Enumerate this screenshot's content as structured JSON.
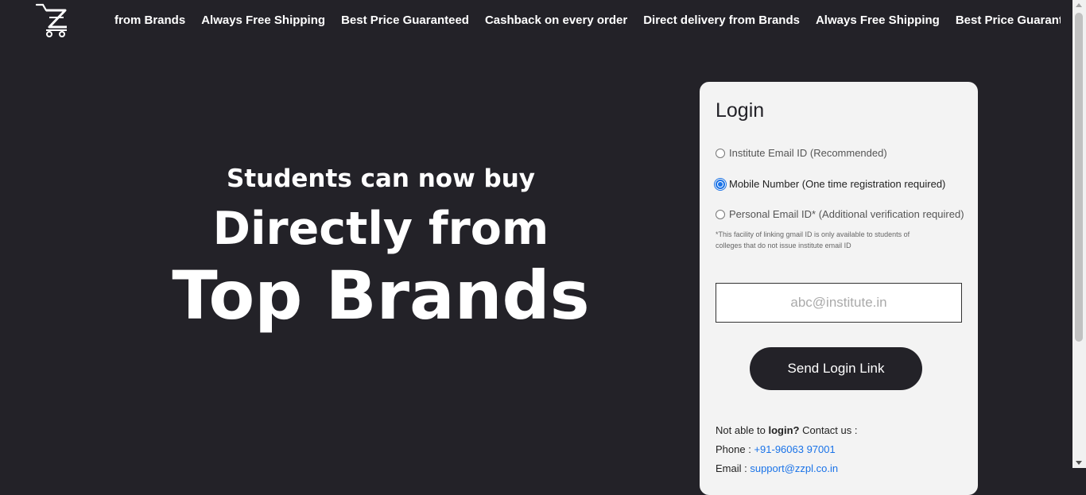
{
  "header": {
    "logo_icon": "cart-z-logo",
    "ticker": [
      "from Brands",
      "Always Free Shipping",
      "Best Price Guaranteed",
      "Cashback on every order",
      "Direct delivery from Brands",
      "Always Free Shipping",
      "Best Price Guarantee"
    ]
  },
  "hero": {
    "line1": "Students can now buy",
    "line2": "Directly from",
    "line3": "Top Brands"
  },
  "login": {
    "title": "Login",
    "options": [
      {
        "label": "Institute Email ID (Recommended)",
        "selected": false
      },
      {
        "label": "Mobile Number (One time registration required)",
        "selected": true
      },
      {
        "label": "Personal Email ID* (Additional verification required)",
        "selected": false
      }
    ],
    "note": "*This facility of linking gmail ID is only available to students of colleges that do not issue institute email ID",
    "input_placeholder": "abc@institute.in",
    "input_value": "",
    "button_label": "Send Login Link",
    "help": {
      "prefix": "Not able to ",
      "bold": "login?",
      "suffix": " Contact us :",
      "phone_label": "Phone : ",
      "phone": "+91-96063 97001",
      "email_label": "Email : ",
      "email": "support@zzpl.co.in"
    }
  },
  "colors": {
    "background": "#232228",
    "card": "#f3f3f3",
    "link": "#1a73e8",
    "button": "#232228"
  }
}
